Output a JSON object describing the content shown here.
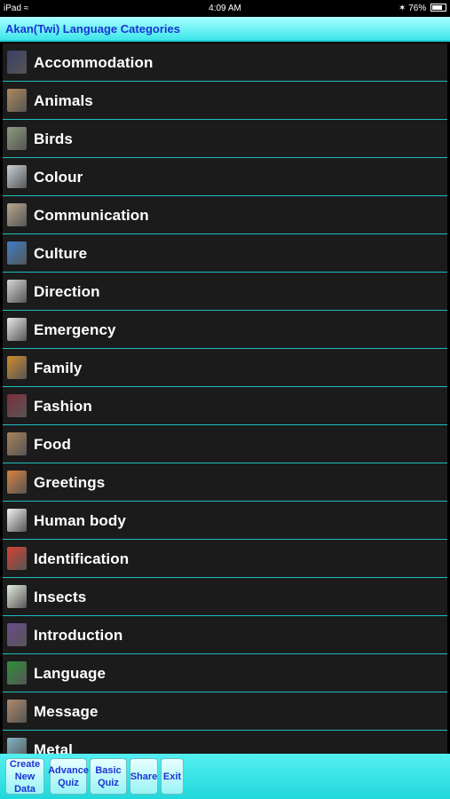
{
  "status_bar": {
    "device": "iPad",
    "time": "4:09 AM",
    "battery": "76%"
  },
  "header": {
    "title": "Akan(Twi) Language Categories"
  },
  "categories": [
    {
      "label": "Accommodation",
      "icon": "building-icon",
      "color": "#3b3f66"
    },
    {
      "label": "Animals",
      "icon": "animals-icon",
      "color": "#b08a5c"
    },
    {
      "label": "Birds",
      "icon": "birds-icon",
      "color": "#8d9a7d"
    },
    {
      "label": "Colour",
      "icon": "colour-icon",
      "color": "#c9d2d8"
    },
    {
      "label": "Communication",
      "icon": "communication-icon",
      "color": "#b9a88d"
    },
    {
      "label": "Culture",
      "icon": "culture-icon",
      "color": "#3d7ec9"
    },
    {
      "label": "Direction",
      "icon": "direction-icon",
      "color": "#d7d7d7"
    },
    {
      "label": "Emergency",
      "icon": "ambulance-icon",
      "color": "#e8e8e8"
    },
    {
      "label": "Family",
      "icon": "family-icon",
      "color": "#d28a2e"
    },
    {
      "label": "Fashion",
      "icon": "dress-icon",
      "color": "#7d2e3a"
    },
    {
      "label": "Food",
      "icon": "food-icon",
      "color": "#a9825a"
    },
    {
      "label": "Greetings",
      "icon": "handshake-icon",
      "color": "#d9813e"
    },
    {
      "label": "Human body",
      "icon": "human-body-icon",
      "color": "#f2f2f2"
    },
    {
      "label": "Identification",
      "icon": "id-card-icon",
      "color": "#d6422f"
    },
    {
      "label": "Insects",
      "icon": "insects-icon",
      "color": "#e6eee0"
    },
    {
      "label": "Introduction",
      "icon": "introduction-icon",
      "color": "#6a4a8a"
    },
    {
      "label": "Language",
      "icon": "language-icon",
      "color": "#2f8f3a"
    },
    {
      "label": "Message",
      "icon": "message-icon",
      "color": "#b08a6a"
    },
    {
      "label": "Metal",
      "icon": "metal-icon",
      "color": "#7fb6c6"
    }
  ],
  "toolbar": [
    {
      "label": "Create\nNew Data",
      "name": "create-new-data-button"
    },
    {
      "label": "Advance\nQuiz",
      "name": "advance-quiz-button"
    },
    {
      "label": "Basic\nQuiz",
      "name": "basic-quiz-button"
    },
    {
      "label": "Share",
      "name": "share-button"
    },
    {
      "label": "Exit",
      "name": "exit-button"
    }
  ]
}
